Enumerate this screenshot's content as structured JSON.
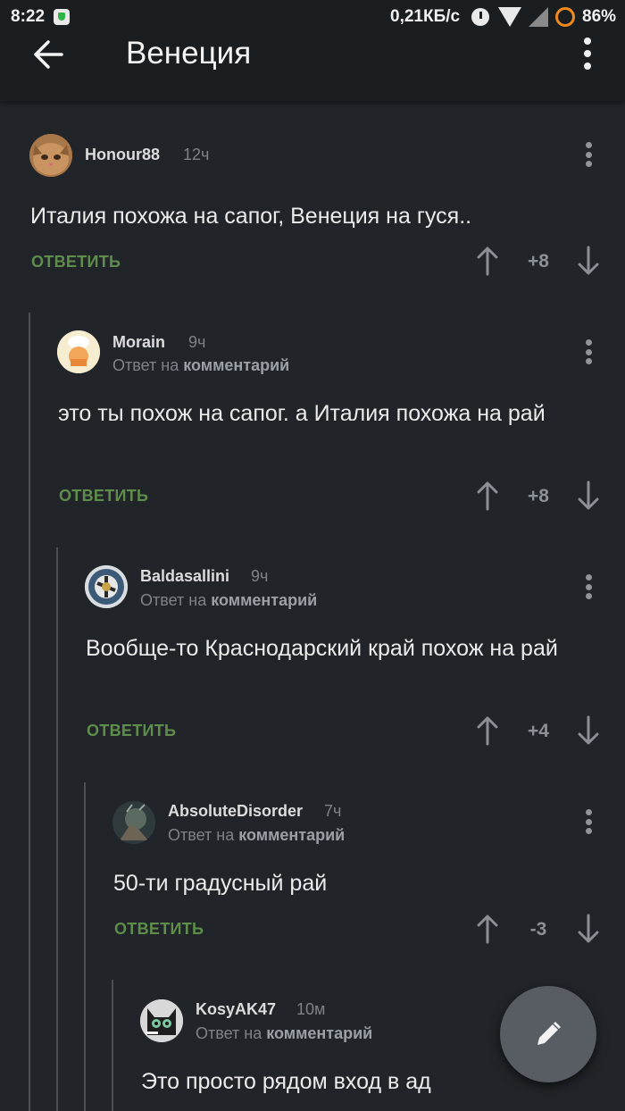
{
  "status_bar": {
    "time": "8:22",
    "net_speed": "0,21КБ/с",
    "battery": "86%",
    "icons": [
      "shield-icon",
      "clock-icon",
      "wifi-icon",
      "cell-signal-icon",
      "battery-icon"
    ]
  },
  "app_bar": {
    "title": "Венеция",
    "icons": [
      "back-arrow-icon",
      "more-vert-icon"
    ]
  },
  "labels": {
    "reply_to_prefix": "Ответ на",
    "reply_to_target": "комментарий",
    "reply_button": "ОТВЕТИТЬ"
  },
  "comments": [
    {
      "username": "Honour88",
      "age": "12ч",
      "text": "Италия похожа на сапог, Венеция на гуся..",
      "score": "+8",
      "is_reply": false
    },
    {
      "username": "Morain",
      "age": "9ч",
      "text": "это ты похож на сапог. а Италия похожа на рай",
      "score": "+8",
      "is_reply": true
    },
    {
      "username": "Baldasallini",
      "age": "9ч",
      "text": "Вообще-то Краснодарский край похож на рай",
      "score": "+4",
      "is_reply": true
    },
    {
      "username": "AbsoluteDisorder",
      "age": "7ч",
      "text": "50-ти градусный рай",
      "score": "-3",
      "is_reply": true
    },
    {
      "username": "KosyAK47",
      "age": "10м",
      "text": "Это просто рядом вход в ад",
      "score": "",
      "is_reply": true
    }
  ],
  "colors": {
    "background": "#212529",
    "reply_button": "#5f8d4b",
    "muted": "#7d8389",
    "fab": "#575d63"
  },
  "fab": {
    "icon": "pencil-icon"
  }
}
